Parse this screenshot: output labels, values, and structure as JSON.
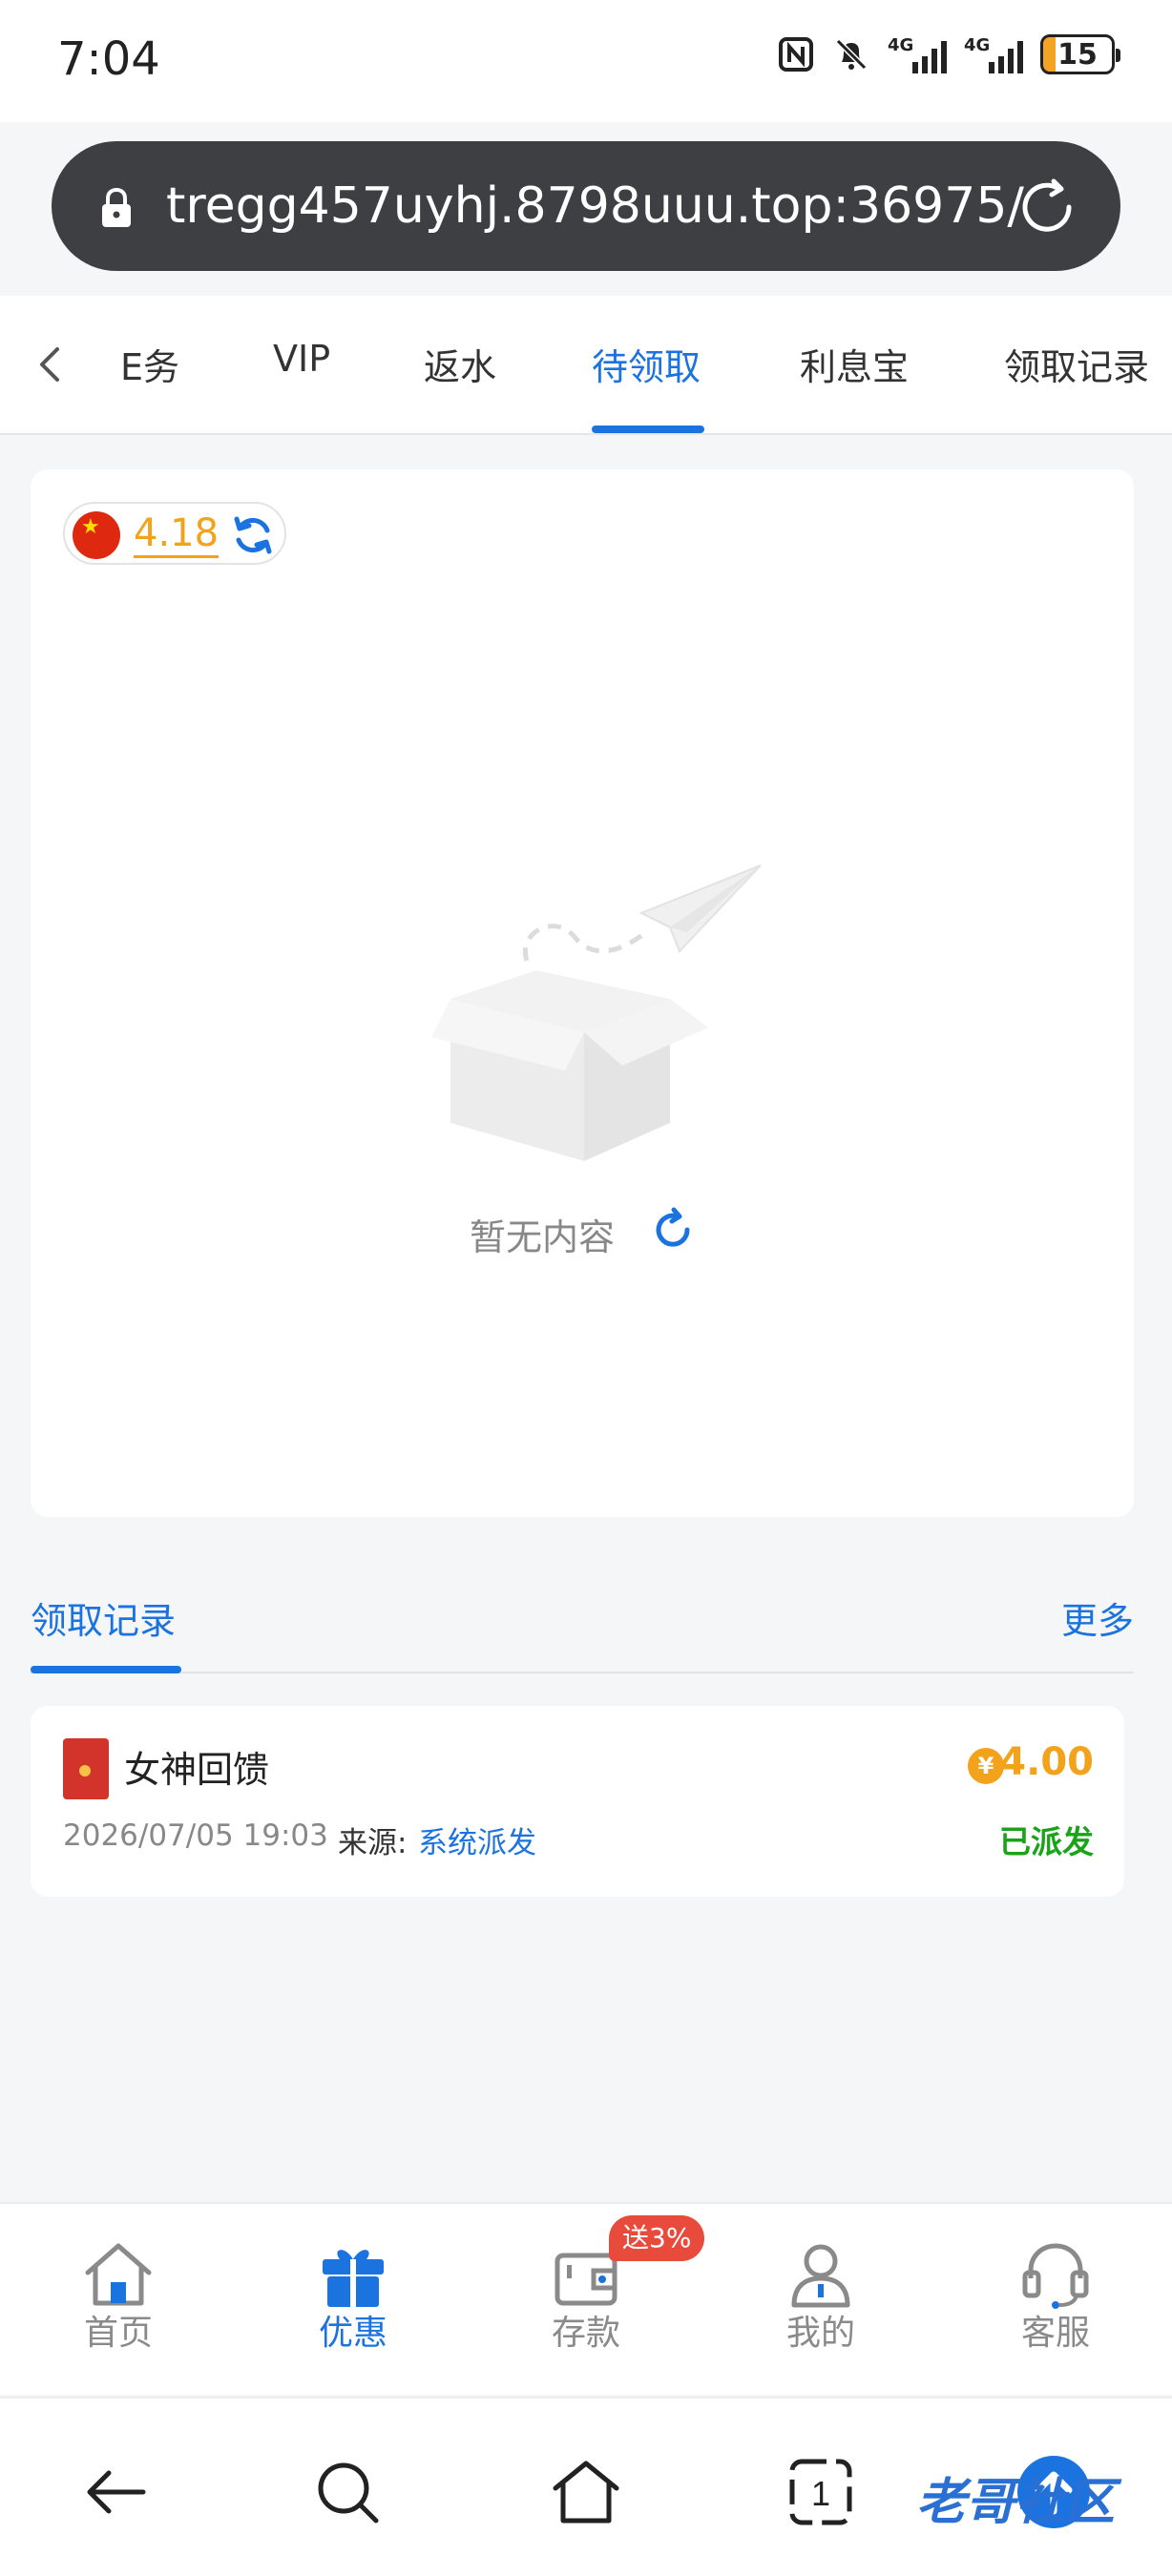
{
  "status_bar": {
    "time": "7:04",
    "signal1_label": "4G",
    "signal2_label": "4G",
    "battery_level": "15"
  },
  "browser": {
    "url": "tregg457uyhj.8798uuu.top:36975/"
  },
  "tabs": {
    "items": [
      "任务",
      "VIP",
      "返水",
      "待领取",
      "利息宝",
      "领取记录"
    ],
    "first_visible_label": "E务",
    "active_index": 3
  },
  "balance": {
    "value": "4.18"
  },
  "empty_state": {
    "text": "暂无内容"
  },
  "records": {
    "title": "领取记录",
    "more_label": "更多",
    "items": [
      {
        "name": "女神回馈",
        "amount": "4.00",
        "date": "2026/07/05 19:03",
        "source_label": "来源:",
        "source_value": "系统派发",
        "status": "已派发"
      }
    ]
  },
  "bottom_nav": {
    "items": [
      {
        "label": "首页",
        "icon": "home-icon"
      },
      {
        "label": "优惠",
        "icon": "gift-icon"
      },
      {
        "label": "存款",
        "icon": "wallet-icon"
      },
      {
        "label": "我的",
        "icon": "user-icon"
      },
      {
        "label": "客服",
        "icon": "headset-icon"
      }
    ],
    "active_index": 1,
    "promo_badge": "送3%"
  },
  "watermark": "老哥社区",
  "colors": {
    "accent": "#1b73e0",
    "gold": "#f2a21b",
    "success": "#19a319",
    "badge": "#e84b3c"
  }
}
